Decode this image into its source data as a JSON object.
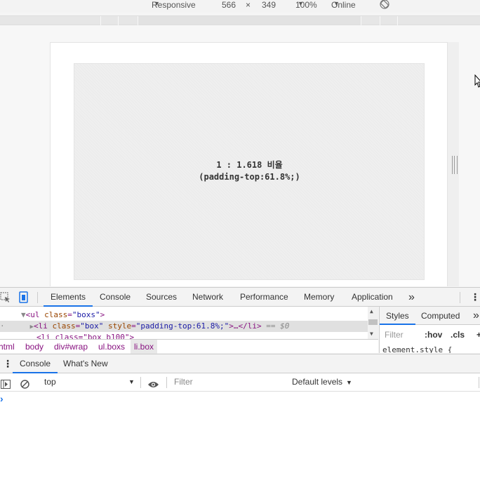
{
  "device_toolbar": {
    "preset": "Responsive",
    "width": "566",
    "times": "×",
    "height": "349",
    "zoom": "100%",
    "network": "Online"
  },
  "page": {
    "box_line1": "1 : 1.618 비율",
    "box_line2": "(padding-top:61.8%;)"
  },
  "devtools": {
    "tabs": [
      "Elements",
      "Console",
      "Sources",
      "Network",
      "Performance",
      "Memory",
      "Application"
    ],
    "active_tab": "Elements",
    "more": "»",
    "elements": {
      "line1_tag_open": "<ul ",
      "line1_attr": "class",
      "line1_eq": "=",
      "line1_val": "\"boxs\"",
      "line1_close": ">",
      "line2_tag_open": "<li ",
      "line2_attr1": "class",
      "line2_val1": "\"box\"",
      "line2_attr2": "style",
      "line2_val2": "\"padding-top:61.8%;\"",
      "line2_close": ">…</li>",
      "line2_eq": " == $0",
      "line3_partial": "<li class=\"box b100\">"
    },
    "breadcrumb": [
      "html",
      "body",
      "div#wrap",
      "ul.boxs",
      "li.box"
    ],
    "styles": {
      "tabs": [
        "Styles",
        "Computed"
      ],
      "active": "Styles",
      "filter_placeholder": "Filter",
      "hov": ":hov",
      "cls": ".cls",
      "plus": "+",
      "rule": "element.style {"
    },
    "drawer": {
      "tabs": [
        "Console",
        "What's New"
      ],
      "active": "Console",
      "context": "top",
      "filter_placeholder": "Filter",
      "levels": "Default levels",
      "prompt": "›"
    }
  },
  "colors": {
    "accent": "#1a73e8",
    "tag": "#881280",
    "attr": "#994500",
    "value": "#1a1aa6"
  }
}
